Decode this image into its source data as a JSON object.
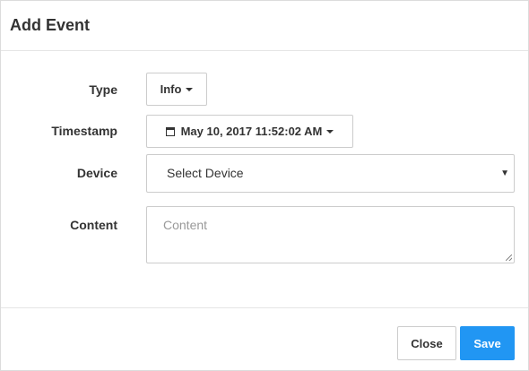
{
  "modal": {
    "title": "Add Event"
  },
  "form": {
    "type": {
      "label": "Type",
      "value": "Info"
    },
    "timestamp": {
      "label": "Timestamp",
      "value": "May 10, 2017 11:52:02 AM"
    },
    "device": {
      "label": "Device",
      "selected": "Select Device"
    },
    "content": {
      "label": "Content",
      "placeholder": "Content"
    }
  },
  "footer": {
    "close_label": "Close",
    "save_label": "Save"
  },
  "colors": {
    "primary": "#2196f3",
    "border": "#cccccc",
    "text": "#333333",
    "placeholder": "#999999"
  },
  "icons": {
    "timestamp": "calendar-icon",
    "dropdown": "caret-down-icon",
    "select": "select-arrow-icon",
    "resize": "resize-grip-icon"
  }
}
